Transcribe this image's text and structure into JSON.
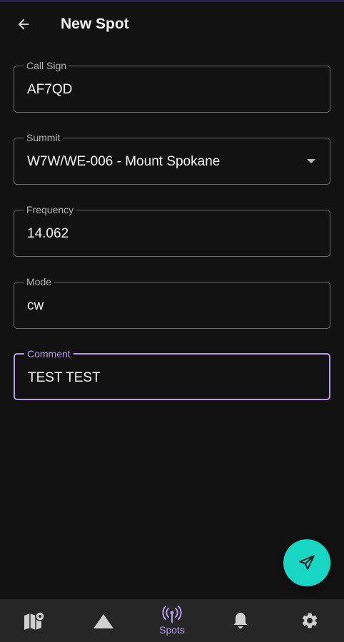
{
  "app_bar": {
    "title": "New Spot",
    "back_icon": "arrow-left-icon"
  },
  "form": {
    "call_sign": {
      "label": "Call Sign",
      "value": "AF7QD"
    },
    "summit": {
      "label": "Summit",
      "value": "W7W/WE-006 - Mount Spokane",
      "dropdown_icon": "caret-down-icon"
    },
    "frequency": {
      "label": "Frequency",
      "value": "14.062"
    },
    "mode": {
      "label": "Mode",
      "value": "cw"
    },
    "comment": {
      "label": "Comment",
      "value": "TEST TEST",
      "focused": true
    }
  },
  "fab": {
    "icon": "send-icon",
    "color": "#17d6c4"
  },
  "bottom_nav": {
    "items": [
      {
        "icon": "map-icon",
        "label": ""
      },
      {
        "icon": "mountain-icon",
        "label": ""
      },
      {
        "icon": "antenna-icon",
        "label": "Spots",
        "active": true
      },
      {
        "icon": "bell-icon",
        "label": ""
      },
      {
        "icon": "gear-icon",
        "label": ""
      }
    ],
    "active_color": "#b79ce8",
    "inactive_color": "#d0d0d0"
  },
  "colors": {
    "background": "#121212",
    "accent": "#b79ce8",
    "fab": "#17d6c4"
  }
}
